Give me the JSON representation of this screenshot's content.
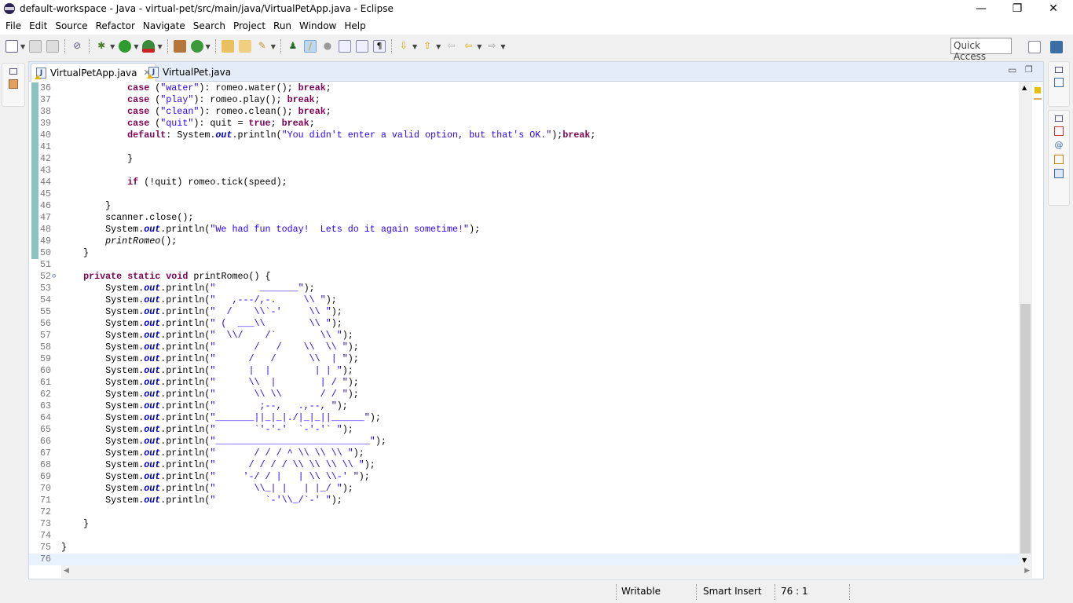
{
  "window": {
    "title": "default-workspace - Java - virtual-pet/src/main/java/VirtualPetApp.java - Eclipse",
    "minimize": "—",
    "restore": "❐",
    "close": "✕"
  },
  "menu": [
    "File",
    "Edit",
    "Source",
    "Refactor",
    "Navigate",
    "Search",
    "Project",
    "Run",
    "Window",
    "Help"
  ],
  "quick_access": {
    "placeholder": "Quick Access"
  },
  "tabs": [
    {
      "label": "VirtualPetApp.java",
      "active": true,
      "close": "✕"
    },
    {
      "label": "VirtualPet.java",
      "active": false
    }
  ],
  "status": {
    "writable": "Writable",
    "insert_mode": "Smart Insert",
    "position": "76 : 1"
  },
  "colors": {
    "keyword": "#7f0055",
    "string": "#2a00ff",
    "field": "#0000c0",
    "current_line": "#e8f2fe"
  },
  "code": {
    "current_line": 76,
    "lines": [
      {
        "n": 36,
        "text": "            case (\"water\"): romeo.water(); break;",
        "changed": true
      },
      {
        "n": 37,
        "text": "            case (\"play\"): romeo.play(); break;",
        "changed": true
      },
      {
        "n": 38,
        "text": "            case (\"clean\"): romeo.clean(); break;",
        "changed": true
      },
      {
        "n": 39,
        "text": "            case (\"quit\"): quit = true; break;",
        "changed": true
      },
      {
        "n": 40,
        "text": "            default: System.out.println(\"You didn't enter a valid option, but that's OK.\");break;",
        "changed": true
      },
      {
        "n": 41,
        "text": "",
        "changed": true
      },
      {
        "n": 42,
        "text": "            }",
        "changed": true
      },
      {
        "n": 43,
        "text": "",
        "changed": true
      },
      {
        "n": 44,
        "text": "            if (!quit) romeo.tick(speed);",
        "changed": true
      },
      {
        "n": 45,
        "text": "",
        "changed": true
      },
      {
        "n": 46,
        "text": "        }",
        "changed": true
      },
      {
        "n": 47,
        "text": "        scanner.close();",
        "changed": true
      },
      {
        "n": 48,
        "text": "        System.out.println(\"We had fun today!  Lets do it again sometime!\");",
        "changed": true
      },
      {
        "n": 49,
        "text": "        printRomeo();",
        "changed": true
      },
      {
        "n": 50,
        "text": "    }",
        "changed": true
      },
      {
        "n": 51,
        "text": ""
      },
      {
        "n": 52,
        "text": "    private static void printRomeo() {",
        "fold": true
      },
      {
        "n": 53,
        "text": "        System.out.println(\"        _______\");"
      },
      {
        "n": 54,
        "text": "        System.out.println(\"   ,---/,-.     \\\\ \");"
      },
      {
        "n": 55,
        "text": "        System.out.println(\"  /    \\\\`-'     \\\\ \");"
      },
      {
        "n": 56,
        "text": "        System.out.println(\" (  ___\\\\        \\\\ \");"
      },
      {
        "n": 57,
        "text": "        System.out.println(\"  \\\\/    /`        \\\\ \");"
      },
      {
        "n": 58,
        "text": "        System.out.println(\"       /   /    \\\\  \\\\ \");"
      },
      {
        "n": 59,
        "text": "        System.out.println(\"      /   /      \\\\  | \");"
      },
      {
        "n": 60,
        "text": "        System.out.println(\"      |  |        | | \");"
      },
      {
        "n": 61,
        "text": "        System.out.println(\"      \\\\  |        | / \");"
      },
      {
        "n": 62,
        "text": "        System.out.println(\"       \\\\ \\\\       / / \");"
      },
      {
        "n": 63,
        "text": "        System.out.println(\"        ;--,   .,--, \");"
      },
      {
        "n": 64,
        "text": "        System.out.println(\"_______||_|_|./|_|_||______\");"
      },
      {
        "n": 65,
        "text": "        System.out.println(\"       `'-'-'  `-'-'` \");"
      },
      {
        "n": 66,
        "text": "        System.out.println(\"____________________________\");"
      },
      {
        "n": 67,
        "text": "        System.out.println(\"       / / / ^ \\\\ \\\\ \\\\ \");"
      },
      {
        "n": 68,
        "text": "        System.out.println(\"      / / / / \\\\ \\\\ \\\\ \\\\ \");"
      },
      {
        "n": 69,
        "text": "        System.out.println(\"     '-/ / |   | \\\\ \\\\-' \");"
      },
      {
        "n": 70,
        "text": "        System.out.println(\"       \\\\_| |   | |_/ \");"
      },
      {
        "n": 71,
        "text": "        System.out.println(\"         `-'\\\\_/`-' \");"
      },
      {
        "n": 72,
        "text": ""
      },
      {
        "n": 73,
        "text": "    }"
      },
      {
        "n": 74,
        "text": ""
      },
      {
        "n": 75,
        "text": "}"
      },
      {
        "n": 76,
        "text": ""
      }
    ]
  }
}
